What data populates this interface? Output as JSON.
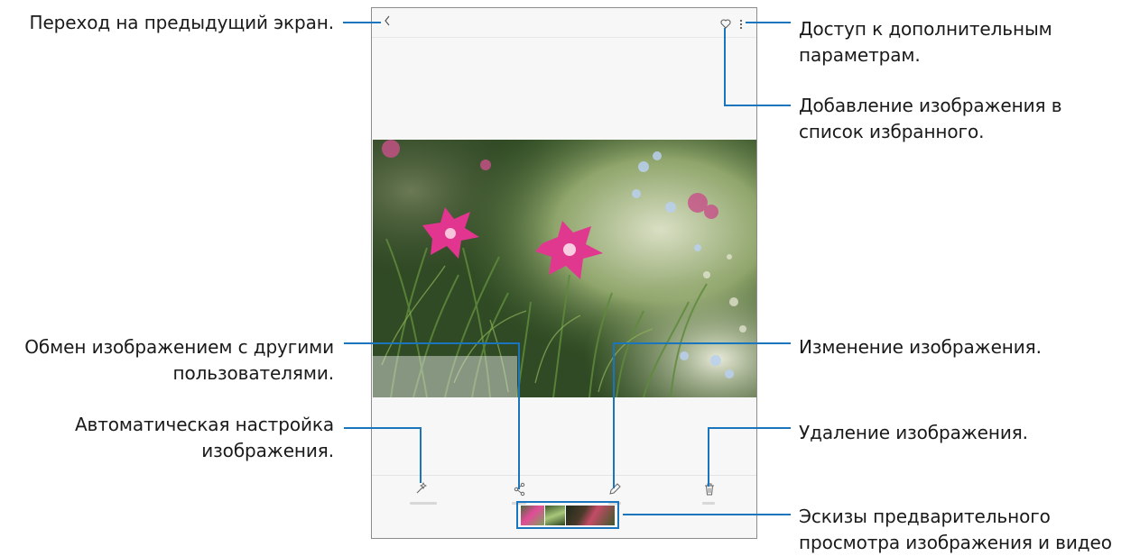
{
  "annotations": {
    "back": "Переход на предыдущий экран.",
    "more_options": [
      "Доступ к дополнительным",
      "параметрам."
    ],
    "favorite": [
      "Добавление изображения в",
      "список избранного."
    ],
    "share": [
      "Обмен изображением с другими",
      "пользователями."
    ],
    "edit": "Изменение изображения.",
    "auto_adjust": [
      "Автоматическая настройка",
      "изображения."
    ],
    "delete": "Удаление изображения.",
    "thumbnails": [
      "Эскизы предварительного",
      "просмотра изображения и видео"
    ]
  },
  "screen": {
    "back_icon": "chevron-left",
    "favorite_icon": "heart-outline",
    "more_icon": "vertical-dots",
    "toolbar": [
      "auto-adjust",
      "share",
      "edit",
      "delete"
    ],
    "thumbnail_count": 3
  },
  "colors": {
    "line": "#1b75bc",
    "box": "#1b75bc"
  }
}
